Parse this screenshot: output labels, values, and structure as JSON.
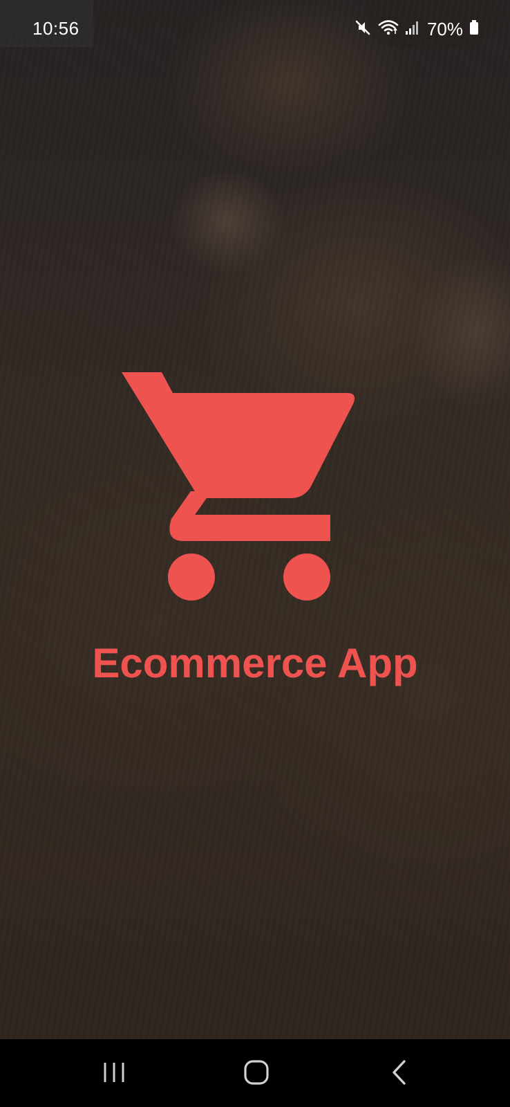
{
  "status_bar": {
    "time": "10:56",
    "battery": "70%",
    "icons": [
      "mute-icon",
      "wifi-icon",
      "signal-icon",
      "battery-icon"
    ]
  },
  "splash": {
    "logo_icon": "shopping-cart-icon",
    "title": "Ecommerce App"
  },
  "nav_bar": {
    "buttons": [
      "recent-apps-icon",
      "home-icon",
      "back-icon"
    ]
  },
  "colors": {
    "accent": "#ef5350",
    "nav_background": "#000000"
  }
}
